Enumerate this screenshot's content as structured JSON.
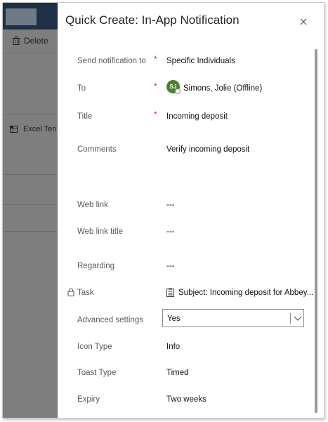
{
  "background": {
    "delete_label": "Delete",
    "excel_label": "Excel Ten"
  },
  "dialog": {
    "title": "Quick Create: In-App Notification"
  },
  "fields": {
    "send_to": {
      "label": "Send notification to",
      "value": "Specific Individuals",
      "required": "*"
    },
    "to": {
      "label": "To",
      "initials": "SJ",
      "value": "Simons, Jolie (Offline)",
      "required": "*"
    },
    "title": {
      "label": "Title",
      "value": "Incoming deposit",
      "required": "*"
    },
    "comments": {
      "label": "Comments",
      "value": "Verify incoming deposit"
    },
    "web_link": {
      "label": "Web link",
      "value": "---"
    },
    "web_link_title": {
      "label": "Web link title",
      "value": "---"
    },
    "regarding": {
      "label": "Regarding",
      "value": "---"
    },
    "task": {
      "label": "Task",
      "value": "Subject: Incoming deposit for Abbey..."
    },
    "advanced_settings": {
      "label": "Advanced settings",
      "value": "Yes"
    },
    "icon_type": {
      "label": "Icon Type",
      "value": "Info"
    },
    "toast_type": {
      "label": "Toast Type",
      "value": "Timed"
    },
    "expiry": {
      "label": "Expiry",
      "value": "Two weeks"
    }
  },
  "colors": {
    "required": "#c23934",
    "avatar": "#4b7f2b",
    "app_header": "#1f2f47",
    "overlay": "#7e7e7e"
  },
  "icons": {
    "close": "close-icon",
    "delete": "trash-icon",
    "excel": "excel-icon",
    "lock": "lock-icon",
    "task": "clipboard-icon",
    "chevron": "chevron-down-icon"
  }
}
